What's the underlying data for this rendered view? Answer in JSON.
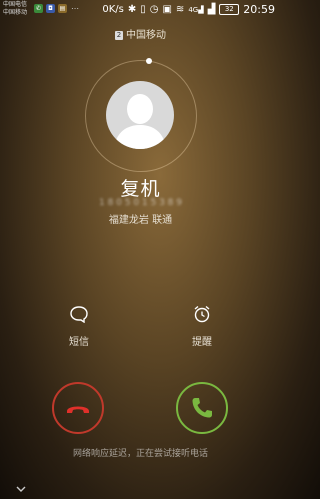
{
  "status_bar": {
    "carrier_1": "中国电信",
    "carrier_2": "中国移动",
    "network_speed": "0K/s",
    "battery": "32",
    "time": "20:59",
    "signal_label": "4G"
  },
  "sim": {
    "badge": "2",
    "label": "中国移动"
  },
  "caller": {
    "name": "复机",
    "number": "1 8 0 5 0 1 5 3 8 9",
    "location": "福建龙岩 联通"
  },
  "actions": {
    "sms_label": "短信",
    "remind_label": "提醒"
  },
  "network_message": "网络响应延迟，正在尝试接听电话",
  "colors": {
    "decline": "#c0392b",
    "answer": "#7ab840"
  }
}
